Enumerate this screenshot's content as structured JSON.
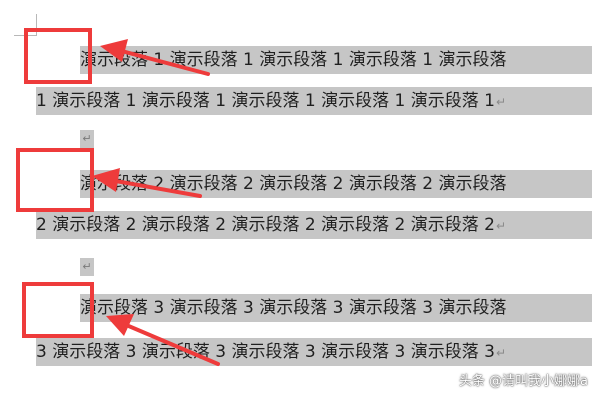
{
  "paragraphs": [
    {
      "first_line": "演示段落 1 演示段落 1 演示段落 1 演示段落 1 演示段落",
      "second_line": "1 演示段落 1 演示段落 1 演示段落 1 演示段落 1 演示段落 1"
    },
    {
      "first_line": "演示段落 2 演示段落 2 演示段落 2 演示段落 2 演示段落",
      "second_line": "2 演示段落 2 演示段落 2 演示段落 2 演示段落 2 演示段落 2"
    },
    {
      "first_line": "演示段落 3 演示段落 3 演示段落 3 演示段落 3 演示段落",
      "second_line": "3 演示段落 3 演示段落 3 演示段落 3 演示段落 3 演示段落 3"
    }
  ],
  "paragraph_mark": "↵",
  "watermark": "头条 @请叫我小娜娜a",
  "colors": {
    "selection": "#c6c6c6",
    "annotation": "#ee3b3b"
  },
  "icons": [
    "paragraph-mark-icon",
    "annotation-arrow-icon"
  ]
}
